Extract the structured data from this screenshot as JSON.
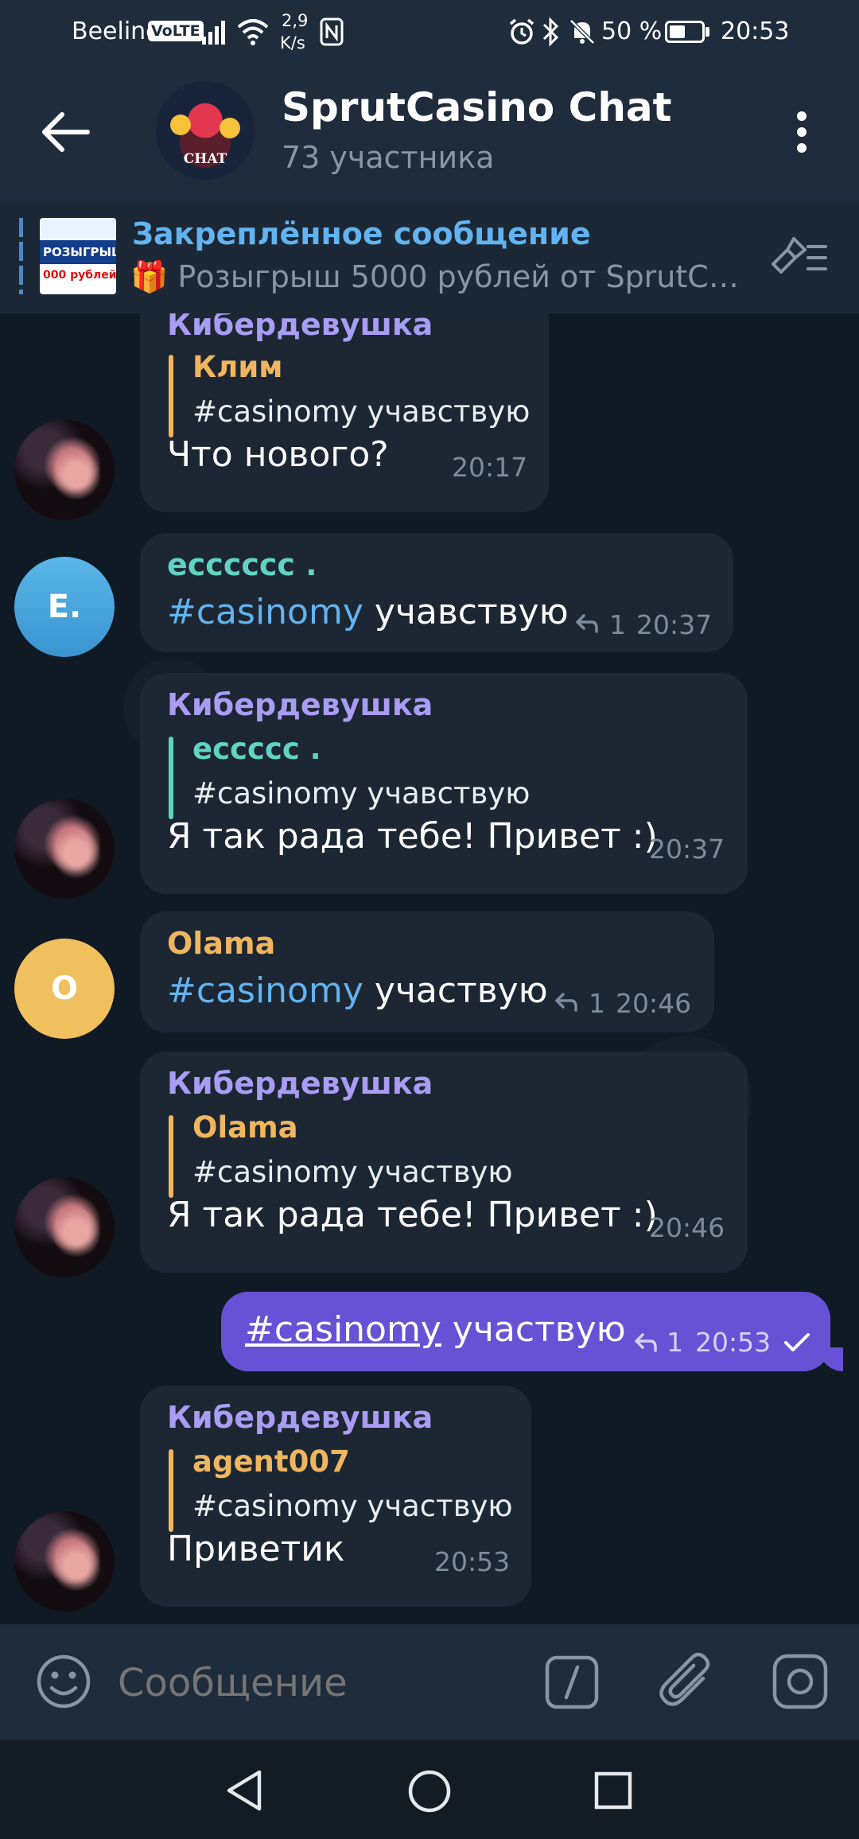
{
  "status_bar": {
    "carrier": "Beeline",
    "volte": "VoLTE",
    "net_speed_value": "2,9",
    "net_speed_unit": "K/s",
    "battery_percent": "50 %",
    "battery_level": 0.5,
    "time": "20:53"
  },
  "header": {
    "title": "SprutCasino Chat",
    "subtitle": "73 участника",
    "avatar_caption": "CHAT"
  },
  "pinned": {
    "title": "Закреплённое сообщение",
    "preview": "🎁 Розыгрыш 5000 рублей от SprutC…",
    "thumb_line1": "РОЗЫГРЫШ!",
    "thumb_line2": "000 рублей"
  },
  "messages": [
    {
      "sender": "Кибердевушка",
      "reply_name": "Клим",
      "reply_text": "#casinomy учавствую",
      "text": "Что нового?",
      "time": "20:17"
    },
    {
      "sender": "ecccccc .",
      "avatar_letter": "E.",
      "hashtag": "#casinomy",
      "text_rest": " учавствую",
      "replies": "1",
      "time": "20:37"
    },
    {
      "sender": "Кибердевушка",
      "reply_name": "eccccc .",
      "reply_text": "#casinomy учавствую",
      "text": "Я так рада тебе! Привет :)",
      "time": "20:37"
    },
    {
      "sender": "Olama",
      "avatar_letter": "O",
      "hashtag": "#casinomy",
      "text_rest": " участвую",
      "replies": "1",
      "time": "20:46"
    },
    {
      "sender": "Кибердевушка",
      "reply_name": "Olama",
      "reply_text": "#casinomy участвую",
      "text": "Я так рада тебе! Привет :)",
      "time": "20:46"
    },
    {
      "outgoing": true,
      "hashtag": "#casinomy",
      "text_rest": " участвую",
      "replies": "1",
      "time": "20:53"
    },
    {
      "sender": "Кибердевушка",
      "reply_name": "agent007",
      "reply_text": "#casinomy участвую",
      "text": "Приветик",
      "time": "20:53"
    }
  ],
  "composer": {
    "placeholder": "Сообщение"
  },
  "colors": {
    "header_bg": "#1f2c3b",
    "chat_bg": "#0f1a24",
    "bubble_in": "#1d2733",
    "bubble_out": "#6752d5",
    "accent_blue": "#62b3f0",
    "name_purple": "#a99cf5",
    "name_teal": "#5fd3c4",
    "name_orange": "#f0b65e"
  },
  "icons": [
    "back-arrow-icon",
    "more-vertical-icon",
    "pin-list-icon",
    "reply-arrow-icon",
    "check-icon",
    "emoji-icon",
    "command-icon",
    "attach-icon",
    "camera-icon",
    "nav-back-icon",
    "nav-home-icon",
    "nav-recents-icon"
  ]
}
